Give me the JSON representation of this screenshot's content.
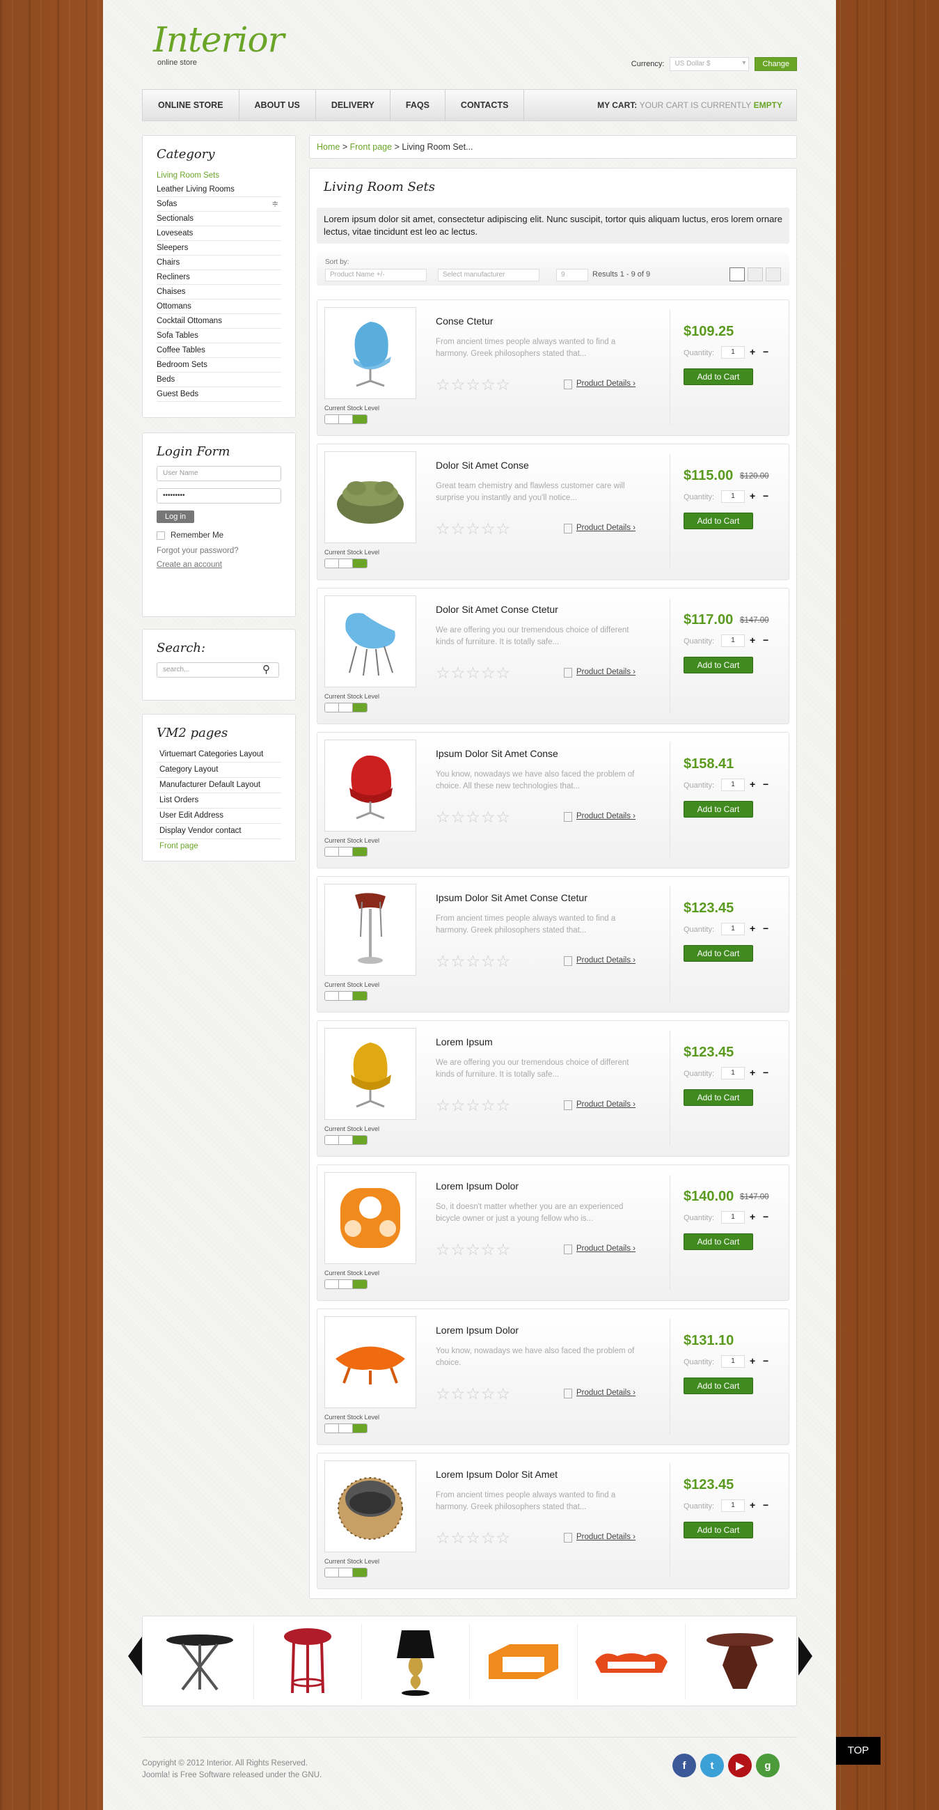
{
  "header": {
    "logo": "Interior",
    "tagline": "online store",
    "currency_label": "Currency:",
    "currency_value": "US Dollar $",
    "change_label": "Change"
  },
  "nav": {
    "items": [
      "Online Store",
      "About Us",
      "Delivery",
      "FAQs",
      "Contacts"
    ],
    "cart_label": "MY CART:",
    "cart_text": "YOUR CART IS CURRENTLY",
    "cart_status": "EMPTY"
  },
  "sidebar": {
    "category_title": "Category",
    "categories": [
      "Living Room Sets",
      "Leather Living Rooms",
      "Sofas",
      "Sectionals",
      "Loveseats",
      "Sleepers",
      "Chairs",
      "Recliners",
      "Chaises",
      "Ottomans",
      "Cocktail Ottomans",
      "Sofa Tables",
      "Coffee Tables",
      "Bedroom Sets",
      "Beds",
      "Guest Beds"
    ],
    "login_title": "Login Form",
    "username_placeholder": "User Name",
    "password_value": "•••••••••",
    "login_button": "Log in",
    "remember_me": "Remember Me",
    "forgot_password": "Forgot your password?",
    "create_account": "Create an account",
    "search_title": "Search:",
    "search_placeholder": "search...",
    "vm2_title": "VM2 pages",
    "vm2_items": [
      "Virtuemart Categories Layout",
      "Category Layout",
      "Manufacturer Default Layout",
      "List Orders",
      "User Edit Address",
      "Display Vendor contact",
      "Front page"
    ]
  },
  "breadcrumb": {
    "home": "Home",
    "sep1": ">",
    "front": "Front page",
    "sep2": ">",
    "current": "Living Room Set..."
  },
  "main": {
    "title": "Living Room Sets",
    "description": "Lorem ipsum dolor sit amet, consectetur adipiscing elit. Nunc suscipit, tortor quis aliquam luctus, eros lorem ornare lectus, vitae tincidunt est leo ac lectus.",
    "sort_label": "Sort by:",
    "sort_value": "Product Name +/-",
    "manufacturer_placeholder": "Select manufacturer",
    "per_page": "9",
    "results": "Results 1 - 9 of 9"
  },
  "product_labels": {
    "stock_label": "Current Stock Level",
    "details_label": "Product Details ›",
    "quantity_label": "Quantity:",
    "quantity_value": "1",
    "add_to_cart": "Add to Cart"
  },
  "products": [
    {
      "name": "Conse Ctetur",
      "desc": "From ancient times people always wanted to find a harmony. Greek philosophers stated that...",
      "price": "$109.25",
      "old_price": "",
      "color": "#5aaede"
    },
    {
      "name": "Dolor Sit Amet Conse",
      "desc": "Great team chemistry and flawless customer care will surprise you instantly and you'll notice...",
      "price": "$115.00",
      "old_price": "$120.00",
      "color": "#6b7a45"
    },
    {
      "name": "Dolor Sit Amet Conse Ctetur",
      "desc": "We are offering you our tremendous choice of different kinds of furniture. It is totally safe...",
      "price": "$117.00",
      "old_price": "$147.00",
      "color": "#6ab8e6"
    },
    {
      "name": "Ipsum Dolor Sit Amet Conse",
      "desc": "You know, nowadays we have also faced the problem of choice. All these new technologies that...",
      "price": "$158.41",
      "old_price": "",
      "color": "#cc1f1f"
    },
    {
      "name": "Ipsum Dolor Sit Amet Conse Ctetur",
      "desc": "From ancient times people always wanted to find a harmony. Greek philosophers stated that...",
      "price": "$123.45",
      "old_price": "",
      "color": "#8a2a1a"
    },
    {
      "name": "Lorem Ipsum",
      "desc": "We are offering you our tremendous choice of different kinds of furniture. It is totally safe...",
      "price": "$123.45",
      "old_price": "",
      "color": "#e0a812"
    },
    {
      "name": "Lorem Ipsum Dolor",
      "desc": "So, it doesn't matter whether you are an experienced bicycle owner or just a young fellow who is...",
      "price": "$140.00",
      "old_price": "$147.00",
      "color": "#f08a1c"
    },
    {
      "name": "Lorem Ipsum Dolor",
      "desc": "You know, nowadays we have also faced the problem of choice.",
      "price": "$131.10",
      "old_price": "",
      "color": "#f06a10"
    },
    {
      "name": "Lorem Ipsum Dolor Sit Amet",
      "desc": "From ancient times people always wanted to find a harmony. Greek philosophers stated that...",
      "price": "$123.45",
      "old_price": "",
      "color": "#555555"
    }
  ],
  "footer": {
    "copyright": "Copyright © 2012 Interior. All Rights Reserved.",
    "joomla": "Joomla! is Free Software released under the GNU.",
    "top_label": "TOP",
    "social": [
      {
        "icon": "facebook-icon",
        "glyph": "f",
        "color": "#3b5998"
      },
      {
        "icon": "twitter-icon",
        "glyph": "t",
        "color": "#3aa0d6"
      },
      {
        "icon": "youtube-icon",
        "glyph": "▶",
        "color": "#b31217"
      },
      {
        "icon": "google-icon",
        "glyph": "g",
        "color": "#4b9b3a"
      }
    ]
  },
  "accent_colors": {
    "green": "#6aa528",
    "cart_button": "#418a1f"
  }
}
